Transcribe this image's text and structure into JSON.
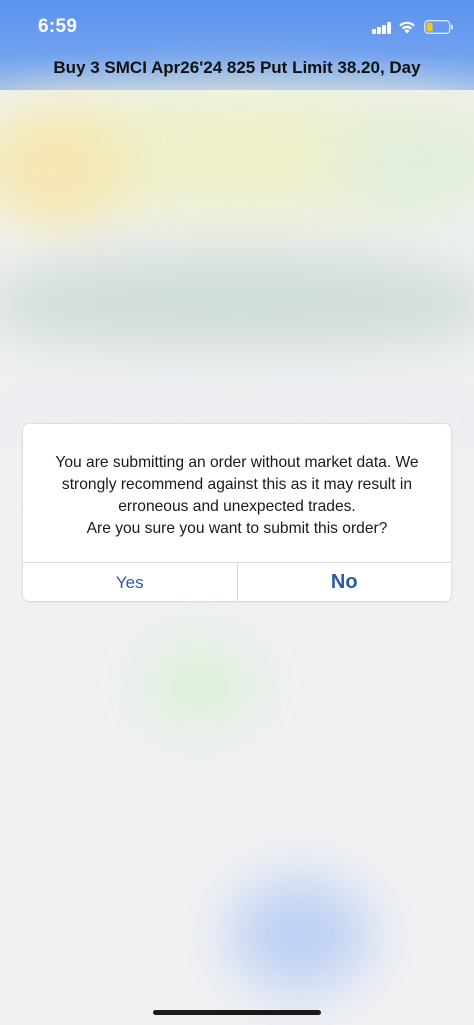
{
  "status_bar": {
    "time": "6:59",
    "icons": [
      "signal-icon",
      "wifi-icon",
      "battery-icon"
    ],
    "battery_color": "#f5c518"
  },
  "header": {
    "order_title": "Buy 3 SMCI Apr26'24 825 Put Limit 38.20, Day"
  },
  "dialog": {
    "message_lines": [
      "You are submitting an order without market data. We",
      "strongly recommend against this as it may result in",
      "erroneous and unexpected trades.",
      "Are you sure you want to submit this order?"
    ],
    "yes_label": "Yes",
    "no_label": "No",
    "button_color": "#2b5aa6"
  }
}
